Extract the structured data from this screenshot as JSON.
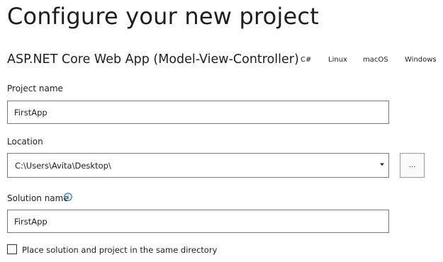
{
  "page": {
    "title": "Configure your new project"
  },
  "template": {
    "name": "ASP.NET Core Web App (Model-View-Controller)",
    "tags": [
      "C#",
      "Linux",
      "macOS",
      "Windows"
    ]
  },
  "project_name": {
    "label": "Project name",
    "value": "FirstApp"
  },
  "location": {
    "label": "Location",
    "value": "C:\\Users\\Avita\\Desktop\\",
    "dropdown_icon": "chevron-down-icon",
    "browse_label": "..."
  },
  "solution_name": {
    "label": "Solution name",
    "info_icon": "info-icon",
    "value": "FirstApp"
  },
  "same_directory": {
    "label": "Place solution and project in the same directory",
    "checked": false
  },
  "colors": {
    "text": "#1e1e1e",
    "border": "#7a7a7a",
    "info_accent": "#0e70c0"
  }
}
